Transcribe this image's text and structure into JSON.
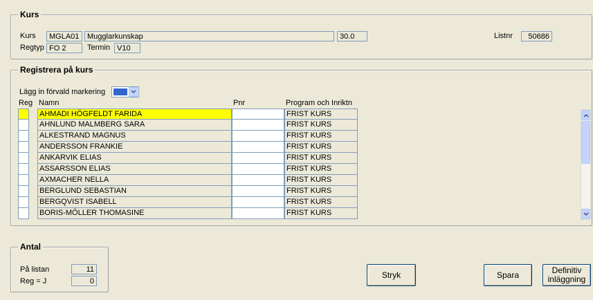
{
  "kurs": {
    "title": "Kurs",
    "kurs_label": "Kurs",
    "kurs_code": "MGLA01",
    "kurs_name": "Mugglarkunskap",
    "points": "30.0",
    "regtyp_label": "Regtyp",
    "regtyp_value": "FO 2",
    "termin_label": "Termin",
    "termin_value": "V10",
    "listnr_label": "Listnr",
    "listnr_value": "50686"
  },
  "registrera": {
    "title": "Registrera på kurs",
    "default_label": "Lägg in förvald markering",
    "default_color": "#3366cc",
    "columns": {
      "reg": "Reg",
      "namn": "Namn",
      "pnr": "Pnr",
      "program": "Program och Inriktn"
    },
    "rows": [
      {
        "reg": "",
        "namn": "AHMADI HÖGFELDT FARIDA",
        "pnr": "",
        "program": "FRIST KURS",
        "highlighted": true
      },
      {
        "reg": "",
        "namn": "AHNLUND MALMBERG SARA",
        "pnr": "",
        "program": "FRIST KURS"
      },
      {
        "reg": "",
        "namn": "ALKESTRAND MAGNUS",
        "pnr": "",
        "program": "FRIST KURS"
      },
      {
        "reg": "",
        "namn": "ANDERSSON FRANKIE",
        "pnr": "",
        "program": "FRIST KURS"
      },
      {
        "reg": "",
        "namn": "ANKARVIK ELIAS",
        "pnr": "",
        "program": "FRIST KURS"
      },
      {
        "reg": "",
        "namn": "ASSARSSON ELIAS",
        "pnr": "",
        "program": "FRIST KURS"
      },
      {
        "reg": "",
        "namn": "AXMACHER NELLA",
        "pnr": "",
        "program": "FRIST KURS"
      },
      {
        "reg": "",
        "namn": "BERGLUND SEBASTIAN",
        "pnr": "",
        "program": "FRIST KURS"
      },
      {
        "reg": "",
        "namn": "BERGQVIST ISABELL",
        "pnr": "",
        "program": "FRIST KURS"
      },
      {
        "reg": "",
        "namn": "BORIS-MÖLLER THOMASINE",
        "pnr": "",
        "program": "FRIST KURS"
      }
    ]
  },
  "antal": {
    "title": "Antal",
    "pa_listan_label": "På listan",
    "pa_listan_value": "11",
    "reg_label": "Reg = J",
    "reg_value": "0"
  },
  "buttons": {
    "stryk": "Stryk",
    "spara": "Spara",
    "definitiv_line1": "Definitiv",
    "definitiv_line2": "inläggning"
  },
  "colors": {
    "highlight": "#ffff00",
    "accent": "#7f9db9"
  }
}
